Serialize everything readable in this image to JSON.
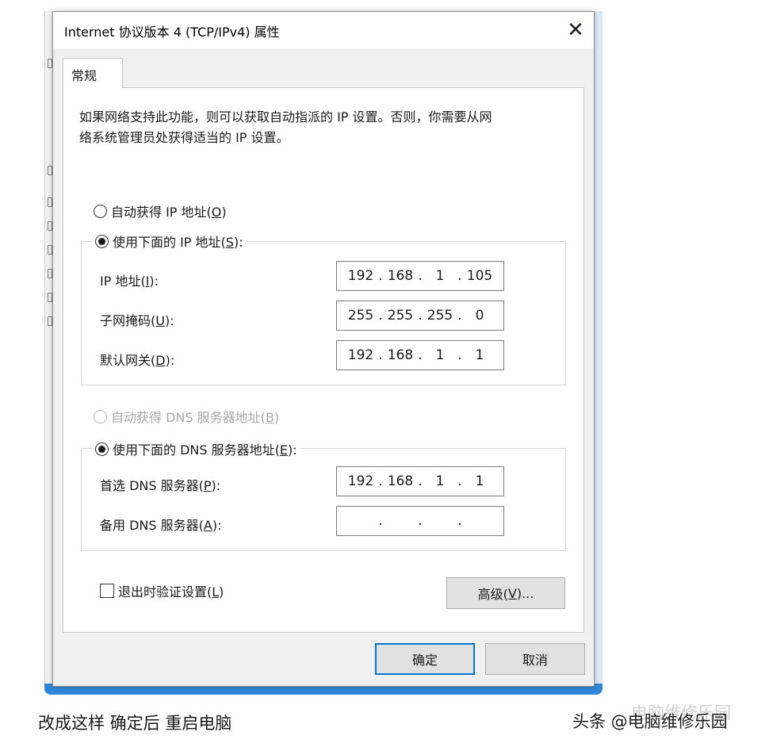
{
  "dialog": {
    "title": "Internet 协议版本 4 (TCP/IPv4) 属性",
    "close_glyph": "✕",
    "tab_label": "常规",
    "description_line1": "如果网络支持此功能，则可以获取自动指派的 IP 设置。否则，你需要从网",
    "description_line2": "络系统管理员处获得适当的 IP 设置。"
  },
  "ip_section": {
    "auto_option": {
      "text": "自动获得 IP 地址(",
      "key": "O",
      "end": ")",
      "checked": false
    },
    "manual_option": {
      "text": "使用下面的 IP 地址(",
      "key": "S",
      "end": "):",
      "checked": true
    },
    "fields": [
      {
        "label": "IP 地址(",
        "key": "I",
        "end": "):",
        "octets": [
          "192",
          "168",
          "1",
          "105"
        ]
      },
      {
        "label": "子网掩码(",
        "key": "U",
        "end": "):",
        "octets": [
          "255",
          "255",
          "255",
          "0"
        ]
      },
      {
        "label": "默认网关(",
        "key": "D",
        "end": "):",
        "octets": [
          "192",
          "168",
          "1",
          "1"
        ]
      }
    ]
  },
  "dns_section": {
    "auto_option": {
      "text": "自动获得 DNS 服务器地址(",
      "key": "B",
      "end": ")",
      "checked": false,
      "disabled": true
    },
    "manual_option": {
      "text": "使用下面的 DNS 服务器地址(",
      "key": "E",
      "end": "):",
      "checked": true
    },
    "fields": [
      {
        "label": "首选 DNS 服务器(",
        "key": "P",
        "end": "):",
        "octets": [
          "192",
          "168",
          "1",
          "1"
        ]
      },
      {
        "label": "备用 DNS 服务器(",
        "key": "A",
        "end": "):",
        "octets": [
          "",
          "",
          "",
          ""
        ]
      }
    ]
  },
  "validate_checkbox": {
    "text": "退出时验证设置(",
    "key": "L",
    "end": ")",
    "checked": false
  },
  "buttons": {
    "advanced": {
      "text": "高级(",
      "key": "V",
      "end": ")..."
    },
    "ok": "确定",
    "cancel": "取消"
  },
  "caption": "改成这样 确定后 重启电脑",
  "watermark": "头条 @电脑维修乐园",
  "watermark_faded": "电脑维修乐园"
}
